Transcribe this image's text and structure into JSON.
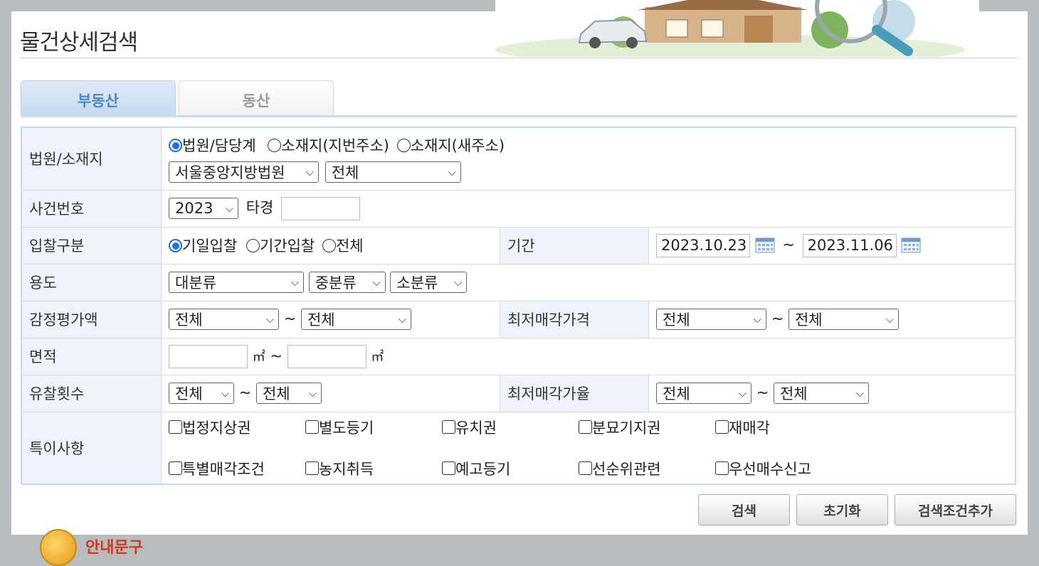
{
  "header": {
    "title": "물건상세검색",
    "banner_icon": "house-car-magnifier-illustration"
  },
  "tabs": [
    {
      "label": "부동산",
      "active": true
    },
    {
      "label": "동산",
      "active": false
    }
  ],
  "form": {
    "court": {
      "label": "법원/소재지",
      "radios": [
        {
          "label": "법원/담당계",
          "checked": true
        },
        {
          "label": "소재지(지번주소)",
          "checked": false
        },
        {
          "label": "소재지(새주소)",
          "checked": false
        }
      ],
      "court_select": "서울중앙지방법원",
      "dept_select": "전체"
    },
    "case_no": {
      "label": "사건번호",
      "year_select": "2023",
      "suffix": "타경",
      "value": ""
    },
    "bid_type": {
      "label": "입찰구분",
      "radios": [
        {
          "label": "기일입찰",
          "checked": true
        },
        {
          "label": "기간입찰",
          "checked": false
        },
        {
          "label": "전체",
          "checked": false
        }
      ],
      "period_label": "기간",
      "date_from": "2023.10.23",
      "date_to": "2023.11.06",
      "tilde": "~"
    },
    "usage": {
      "label": "용도",
      "major": "대분류",
      "middle": "중분류",
      "minor": "소분류"
    },
    "appraisal": {
      "label": "감정평가액",
      "from": "전체",
      "to": "전체",
      "min_price_label": "최저매각가격",
      "min_from": "전체",
      "min_to": "전체"
    },
    "area": {
      "label": "면적",
      "unit": "㎡",
      "from": "",
      "to": ""
    },
    "fail_count": {
      "label": "유찰횟수",
      "from": "전체",
      "to": "전체",
      "min_rate_label": "최저매각가율",
      "rate_from": "전체",
      "rate_to": "전체"
    },
    "special": {
      "label": "특이사항",
      "items": [
        "법정지상권",
        "별도등기",
        "유치권",
        "분묘기지권",
        "재매각",
        "특별매각조건",
        "농지취득",
        "예고등기",
        "선순위관련",
        "우선매수신고"
      ]
    }
  },
  "buttons": {
    "search": "검색",
    "reset": "초기화",
    "add_condition": "검색조건추가"
  },
  "notice": {
    "text": "안내문구"
  },
  "colors": {
    "tab_active": "#4a86c8",
    "label_bg": "#eef3f9",
    "radio_on": "#1e6ff0"
  }
}
